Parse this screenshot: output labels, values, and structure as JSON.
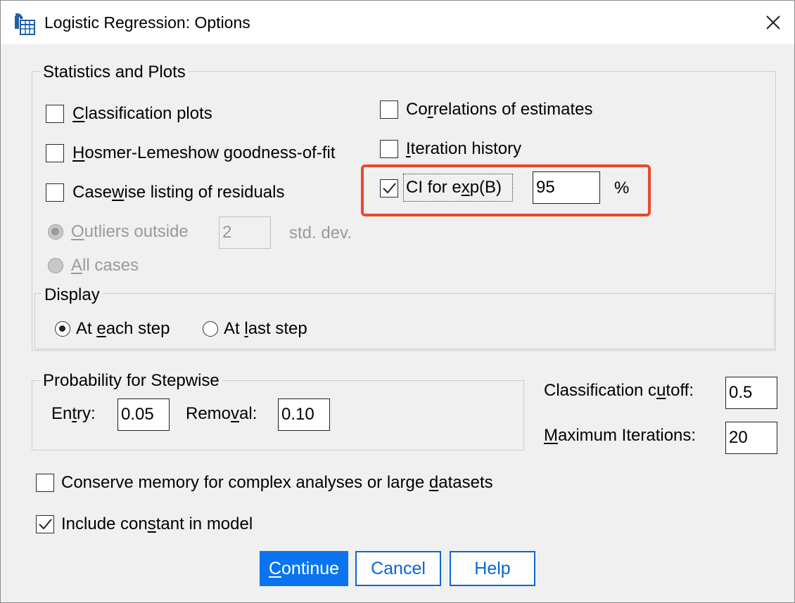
{
  "window": {
    "title": "Logistic Regression: Options",
    "close_icon": "close-x-icon"
  },
  "statistics": {
    "group_label": "Statistics and Plots",
    "classification_plots": {
      "pre": "",
      "acc": "C",
      "post": "lassification plots",
      "checked": false
    },
    "hosmer": {
      "pre": "",
      "acc": "H",
      "post": "osmer-Lemeshow goodness-of-fit",
      "checked": false
    },
    "casewise": {
      "pre": "Case",
      "acc": "w",
      "post": "ise listing of residuals",
      "checked": false
    },
    "outliers": {
      "pre": "",
      "acc": "O",
      "post": "utliers outside",
      "selected": true
    },
    "outliers_value": "2",
    "std_dev_label": "std. dev.",
    "all_cases": {
      "pre": "",
      "acc": "A",
      "post": "ll cases",
      "selected": false
    },
    "correlations": {
      "pre": "Co",
      "acc": "r",
      "post": "relations of estimates",
      "checked": false
    },
    "iteration_history": {
      "pre": "",
      "acc": "I",
      "post": "teration history",
      "checked": false
    },
    "ci_exp": {
      "pre": "CI for e",
      "acc": "x",
      "post": "p(B)",
      "checked": true
    },
    "ci_value": "95",
    "ci_unit": "%"
  },
  "display": {
    "group_label": "Display",
    "each_step": {
      "pre": "At ",
      "acc": "e",
      "post": "ach step",
      "selected": true
    },
    "last_step": {
      "pre": "At ",
      "acc": "l",
      "post": "ast step",
      "selected": false
    }
  },
  "stepwise": {
    "group_label": "Probability for Stepwise",
    "entry": {
      "pre": "En",
      "acc": "t",
      "post": "ry:"
    },
    "entry_value": "0.05",
    "removal": {
      "pre": "Remo",
      "acc": "v",
      "post": "al:"
    },
    "removal_value": "0.10"
  },
  "cutoff": {
    "label": {
      "pre": "Classification c",
      "acc": "u",
      "post": "toff:"
    },
    "value": "0.5"
  },
  "max_iterations": {
    "label": {
      "pre": "",
      "acc": "M",
      "post": "aximum Iterations:"
    },
    "value": "20"
  },
  "conserve_memory": {
    "pre": "Conserve memory for complex analyses or large ",
    "acc": "d",
    "post": "atasets",
    "checked": false
  },
  "include_constant": {
    "pre": "Include con",
    "acc": "s",
    "post": "tant in model",
    "checked": true
  },
  "buttons": {
    "continue": {
      "pre": "",
      "acc": "C",
      "post": "ontinue"
    },
    "cancel": "Cancel",
    "help": "Help"
  },
  "colors": {
    "accent": "#0a74f0",
    "highlight": "#e8492e"
  }
}
